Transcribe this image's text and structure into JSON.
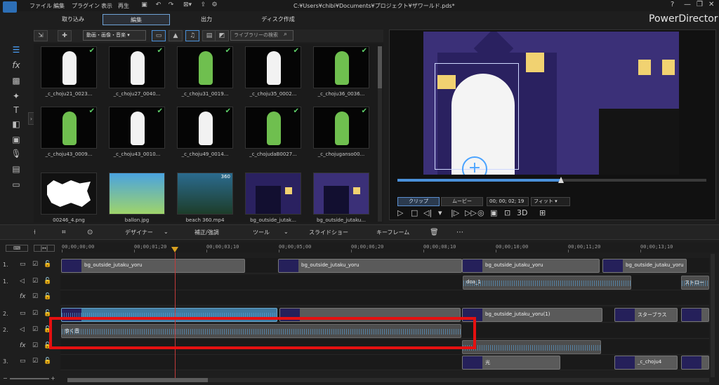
{
  "menu": [
    "ファイル",
    "編集",
    "プラグイン",
    "表示",
    "再生"
  ],
  "file_path": "C:¥Users¥chibi¥Documents¥プロジェクト¥ザワールド.pds*",
  "window_controls": [
    "?",
    "—",
    "❐",
    "✕"
  ],
  "mode_tabs": [
    "取り込み",
    "編集",
    "出力",
    "ディスク作成"
  ],
  "brand": "PowerDirector",
  "library": {
    "filter": "動画・画像・音楽",
    "search_placeholder": "ライブラリーの検索",
    "items": [
      {
        "label": "_c_choju21_0023...",
        "kind": "rabbit"
      },
      {
        "label": "_c_choju27_0040...",
        "kind": "rabbit"
      },
      {
        "label": "_c_choju31_0019...",
        "kind": "frog"
      },
      {
        "label": "_c_choju35_0002...",
        "kind": "rabbit"
      },
      {
        "label": "_c_choju36_0036...",
        "kind": "frog"
      },
      {
        "label": "_c_choju43_0009...",
        "kind": "frog"
      },
      {
        "label": "_c_choju43_0010...",
        "kind": "rabbit"
      },
      {
        "label": "_c_choju49_0014...",
        "kind": "rabbit"
      },
      {
        "label": "_c_chojudaB0027...",
        "kind": "frog"
      },
      {
        "label": "_c_chojuganso00...",
        "kind": "frog"
      },
      {
        "label": "00246_4.png",
        "kind": "burst"
      },
      {
        "label": "ballon.jpg",
        "kind": "sky"
      },
      {
        "label": "beach 360.mp4",
        "kind": "beach",
        "badge": "360"
      },
      {
        "label": "bg_outside_jutak...",
        "kind": "night"
      },
      {
        "label": "bg_outside_jutaku...",
        "kind": "night2"
      }
    ]
  },
  "preview": {
    "clip_button": "クリップ",
    "movie_button": "ムービー",
    "timecode": "00; 00; 02; 19",
    "fit": "フィット",
    "mode_3d": "3D",
    "progress": 0.53
  },
  "timeline_tools": [
    "デザイナー",
    "補正/強調",
    "ツール",
    "スライドショー",
    "キーフレーム"
  ],
  "ruler": [
    "00;00;00;00",
    "00;00;01;20",
    "00;00;03;10",
    "00;00;05;00",
    "00;00;06;20",
    "00;00;08;10",
    "00;00;10;00",
    "00;00;11;20",
    "00;00;13;10"
  ],
  "tracks": [
    {
      "num": "1.",
      "icon": "▭",
      "clips": [
        {
          "label": "bg_outside_jutaku_yoru",
          "type": "video"
        },
        {
          "label": "bg_outside_jutaku_yoru",
          "type": "video"
        },
        {
          "label": "bg_outside_jutaku_yoru",
          "type": "video"
        },
        {
          "label": "bg_outside_jutaku_yoru",
          "type": "video"
        }
      ]
    },
    {
      "num": "1.",
      "icon": "◁",
      "clips": [
        {
          "label": "doa_1",
          "type": "audio"
        },
        {
          "label": "ストロー",
          "type": "audio"
        }
      ]
    },
    {
      "num": "",
      "icon": "fx",
      "clips": []
    },
    {
      "num": "2.",
      "icon": "▭",
      "clips": [
        {
          "label": "",
          "type": "blue"
        },
        {
          "label": "",
          "type": "video"
        },
        {
          "label": "bg_outside_jutaku_yoru(1)",
          "type": "video"
        },
        {
          "label": "スターブラス",
          "type": "video"
        },
        {
          "label": "",
          "type": "video"
        }
      ]
    },
    {
      "num": "2.",
      "icon": "◁",
      "clips": [
        {
          "label": "歩く音",
          "type": "audio"
        }
      ]
    },
    {
      "num": "",
      "icon": "fx",
      "clips": [
        {
          "label": "",
          "type": "audio"
        }
      ]
    },
    {
      "num": "3.",
      "icon": "▭",
      "clips": [
        {
          "label": "光",
          "type": "video"
        },
        {
          "label": "_c_choju4",
          "type": "video"
        },
        {
          "label": "",
          "type": "video"
        }
      ]
    }
  ]
}
